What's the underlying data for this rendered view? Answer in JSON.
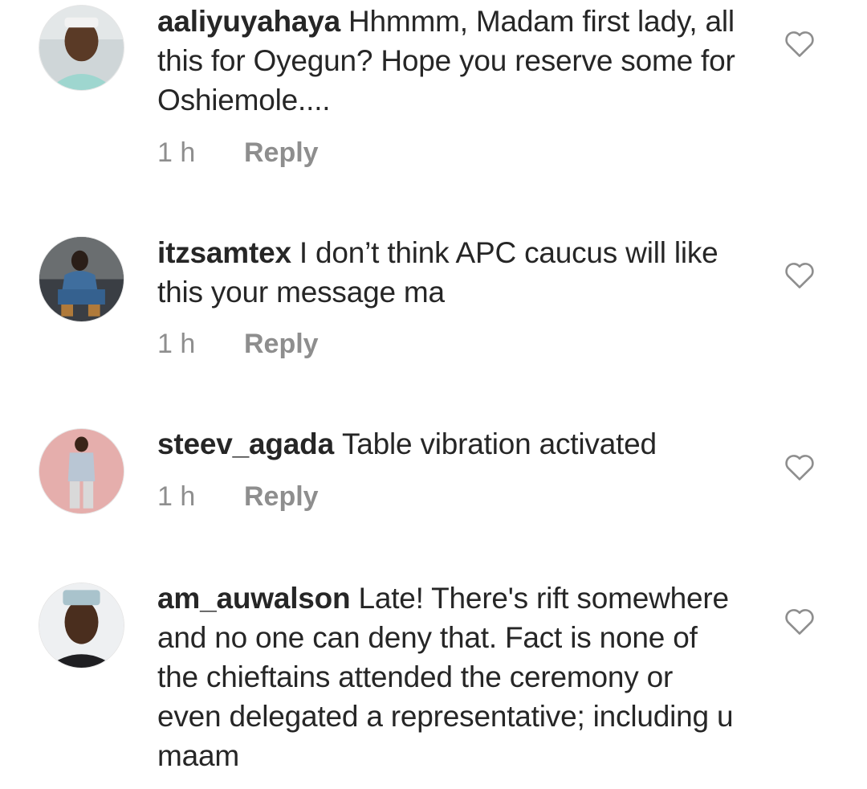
{
  "comments": [
    {
      "username": "aaliyuyahaya",
      "text": "Hhmmm, Madam first lady, all this for Oyegun? Hope you reserve some for Oshiemole....",
      "time": "1 h",
      "reply_label": "Reply",
      "avatar_icon": "avatar-man-white-cap"
    },
    {
      "username": "itzsamtex",
      "text": "I don’t think APC caucus will like this your message ma",
      "time": "1 h",
      "reply_label": "Reply",
      "avatar_icon": "avatar-seated-person"
    },
    {
      "username": "steev_agada",
      "text": "Table vibration activated",
      "time": "1 h",
      "reply_label": "Reply",
      "avatar_icon": "avatar-standing-man"
    },
    {
      "username": "am_auwalson",
      "text": "Late! There's rift somewhere and no one can deny that. Fact is none of the chieftains attended the ceremony or even delegated a representative; including u maam",
      "avatar_icon": "avatar-man-cap"
    }
  ],
  "icons": {
    "like": "heart-outline-icon"
  },
  "colors": {
    "text": "#262626",
    "meta": "#8e8e8e",
    "heart": "#8e8e8e"
  }
}
